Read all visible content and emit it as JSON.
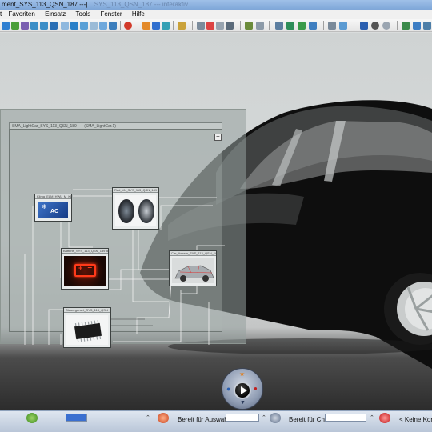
{
  "window": {
    "title": "ment_SYS_113_QSN_187 ---]",
    "title_faint": "SYS_113_QSN_187 --- interaktiv"
  },
  "menu": {
    "items": [
      "t",
      "Favoriten",
      "Einsatz",
      "Tools",
      "Fenster",
      "Hilfe"
    ]
  },
  "schematic": {
    "header": "SMA_LightCar_SYS_113_QSN_189 ---- (SMA_LightCar.1)",
    "collapse_symbol": "–",
    "blocks": {
      "climate": {
        "caption": "Klima_ELM_HWL_M_KD_Teil",
        "badge": "AC"
      },
      "wheel": {
        "caption": "Rad_VL_SYS_113_QSN_189 A"
      },
      "battery": {
        "caption": "Batterie_SYS_113_QSN_189 B"
      },
      "vehicle": {
        "caption": "Car_Assem_SYS_113_QSN_189 VAR"
      },
      "chip": {
        "caption": "Steuergeraet_SYS_113_QSN"
      }
    }
  },
  "taskbar": {
    "status_auswahl": "Bereit für Auswahl",
    "status_chat": "Bereit für Chat",
    "status_konf": "< Keine Konfi"
  },
  "colors": {
    "title_bar": "#8fb3e0",
    "viewport": "#d4d8d8",
    "car_body": "#0e0e0e",
    "battery_bg": "#1a0804",
    "battery_glow": "#ff3a1a",
    "ac_blue": "#1d4fa3"
  }
}
